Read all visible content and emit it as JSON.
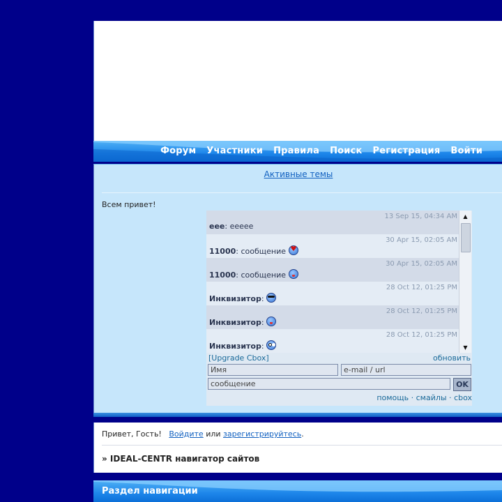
{
  "nav": {
    "items": [
      "Форум",
      "Участники",
      "Правила",
      "Поиск",
      "Регистрация",
      "Войти"
    ]
  },
  "main": {
    "active_topics": "Активные темы",
    "greeting": "Всем привет!"
  },
  "cbox": {
    "messages": [
      {
        "time": "13 Sep 15, 04:34 AM",
        "author": "eee",
        "text": ": eeeee",
        "smiley": ""
      },
      {
        "time": "30 Apr 15, 02:05 AM",
        "author": "11000",
        "text": ": сообщение ",
        "smiley": "heart-smiley-icon"
      },
      {
        "time": "30 Apr 15, 02:05 AM",
        "author": "11000",
        "text": ": сообщение ",
        "smiley": "tongue-smiley-icon"
      },
      {
        "time": "28 Oct 12, 01:25 PM",
        "author": "Инквизитор",
        "text": ": ",
        "smiley": "cool-smiley-icon"
      },
      {
        "time": "28 Oct 12, 01:25 PM",
        "author": "Инквизитор",
        "text": ": ",
        "smiley": "tongue-smiley-icon"
      },
      {
        "time": "28 Oct 12, 01:25 PM",
        "author": "Инквизитор",
        "text": ": ",
        "smiley": "rolleyes-smiley-icon"
      }
    ],
    "upgrade": "[Upgrade Cbox]",
    "refresh": "обновить",
    "name_placeholder": "Имя",
    "url_placeholder": "e-mail / url",
    "message_placeholder": "сообщение",
    "ok": "OK",
    "footer": {
      "help": "помощь",
      "smileys": "смайлы",
      "cbox": "cbox",
      "sep": " · "
    }
  },
  "guest": {
    "hello": "Привет, Гость!",
    "login": "Войдите",
    "or": " или ",
    "register": "зарегистрируйтесь",
    "period": ".",
    "navigator": "» IDEAL-CENTR навигатор сайтов"
  },
  "section": {
    "title": "Раздел навигации"
  }
}
